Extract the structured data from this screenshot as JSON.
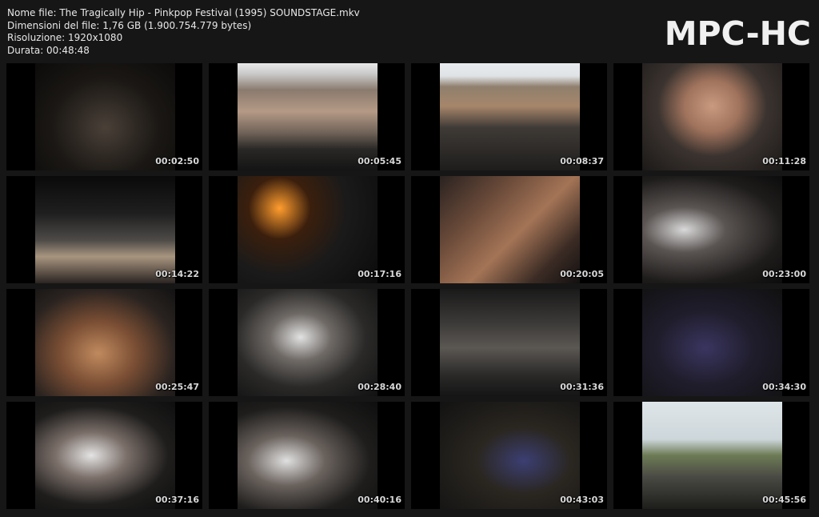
{
  "info": {
    "filename": "Nome file: The Tragically Hip - Pinkpop Festival (1995) SOUNDSTAGE.mkv",
    "filesize": "Dimensioni del file: 1,76 GB (1.900.754.779 bytes)",
    "resolution": "Risoluzione: 1920x1080",
    "duration": "Durata: 00:48:48"
  },
  "logo": "MPC-HC",
  "thumbnails": [
    {
      "time": "00:02:50",
      "scene": "band-on-stage-dark"
    },
    {
      "time": "00:05:45",
      "scene": "stadium-crowd-wide"
    },
    {
      "time": "00:08:37",
      "scene": "stage-daylight-crowd"
    },
    {
      "time": "00:11:28",
      "scene": "singer-closeup"
    },
    {
      "time": "00:14:22",
      "scene": "stage-wide-flags-crowd"
    },
    {
      "time": "00:17:16",
      "scene": "stage-lights-guitarist"
    },
    {
      "time": "00:20:05",
      "scene": "guitarist-hair-closeup"
    },
    {
      "time": "00:23:00",
      "scene": "singer-drummer"
    },
    {
      "time": "00:25:47",
      "scene": "drummer-kit"
    },
    {
      "time": "00:28:40",
      "scene": "singer-mic-stand"
    },
    {
      "time": "00:31:36",
      "scene": "stage-wide-band"
    },
    {
      "time": "00:34:30",
      "scene": "guitarist-blue-shirt"
    },
    {
      "time": "00:37:16",
      "scene": "singer-singing"
    },
    {
      "time": "00:40:16",
      "scene": "singer-drummer-2"
    },
    {
      "time": "00:43:03",
      "scene": "guitarist-stage-left"
    },
    {
      "time": "00:45:56",
      "scene": "singer-festival-sky"
    }
  ]
}
